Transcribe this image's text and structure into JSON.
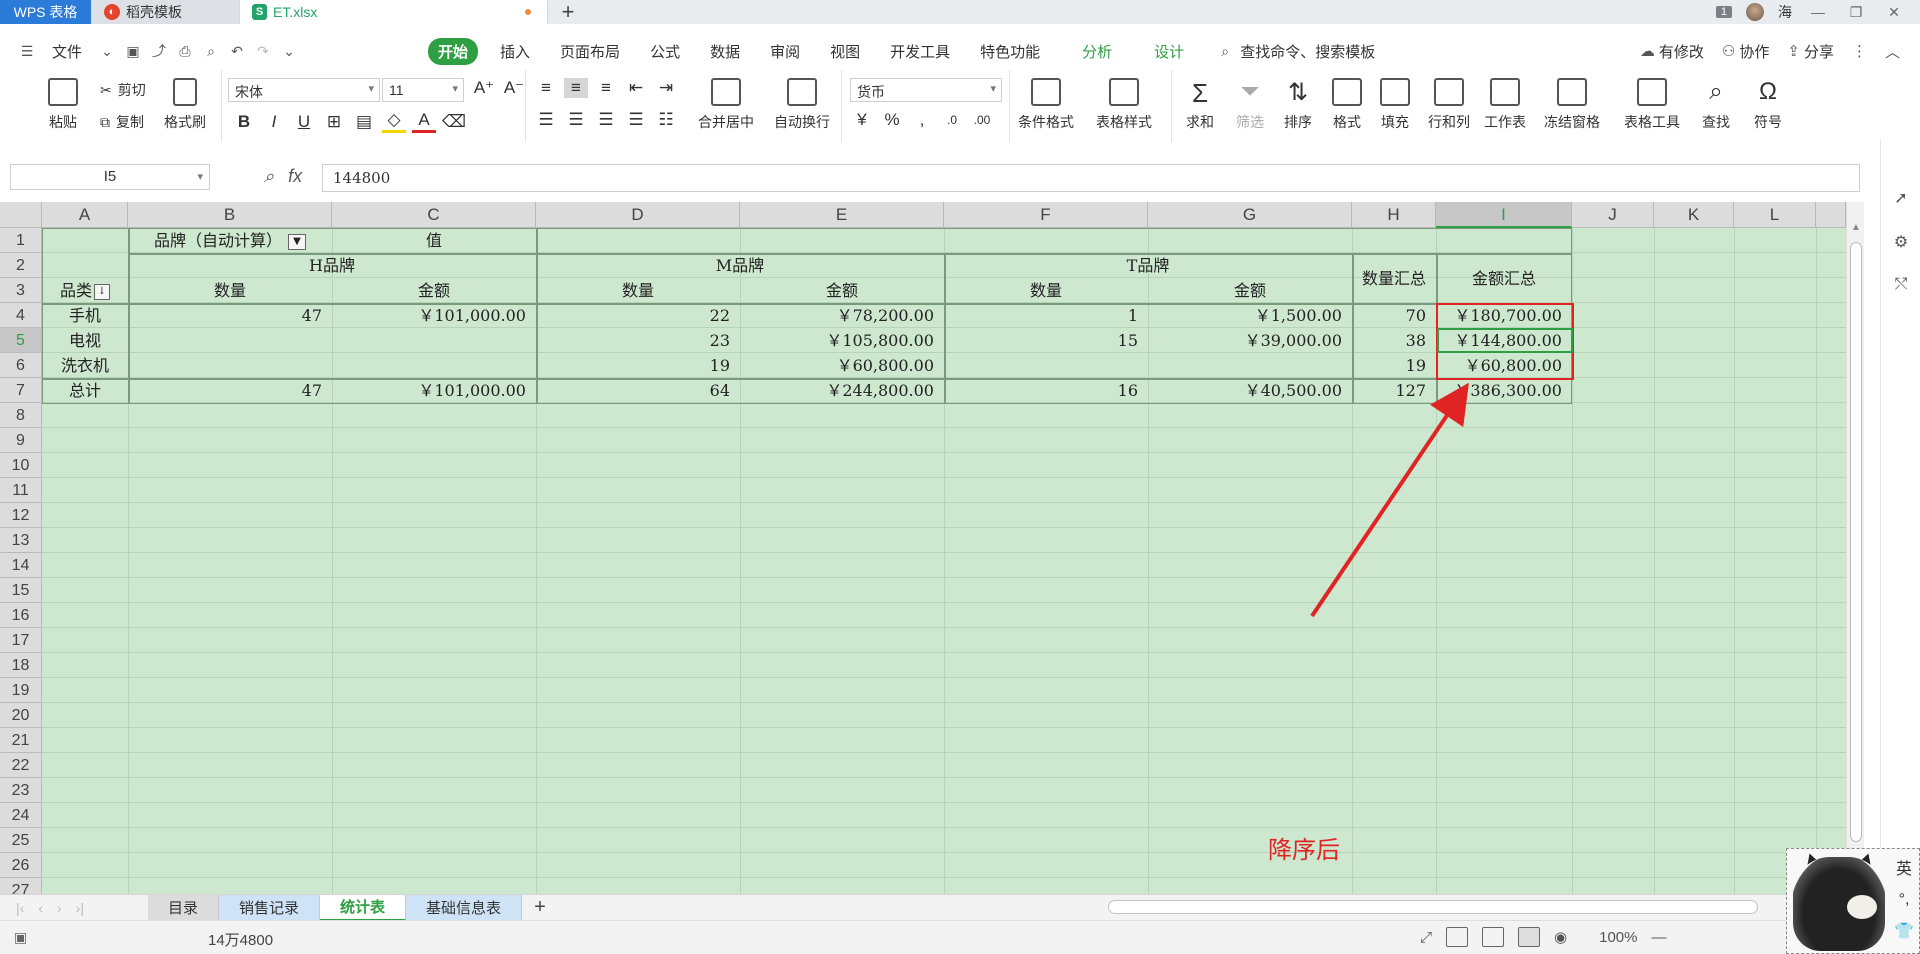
{
  "titlebar": {
    "tab_wps": "WPS 表格",
    "tab_template": "稻壳模板",
    "tab_file": "ET.xlsx",
    "template_icon": "daoke-logo-icon",
    "file_icon": "spreadsheet-icon",
    "count_badge": "1",
    "user_name": "海"
  },
  "menubar": {
    "file_label": "文件",
    "tabs": [
      "开始",
      "插入",
      "页面布局",
      "公式",
      "数据",
      "审阅",
      "视图",
      "开发工具",
      "特色功能",
      "分析",
      "设计"
    ],
    "search_placeholder": "查找命令、搜索模板",
    "has_changes": "有修改",
    "collab": "协作",
    "share": "分享"
  },
  "ribbon": {
    "paste": "粘贴",
    "cut": "剪切",
    "copy": "复制",
    "format_painter": "格式刷",
    "font_name": "宋体",
    "font_size": "11",
    "merge_center": "合并居中",
    "wrap_text": "自动换行",
    "number_format": "货币",
    "conditional_format": "条件格式",
    "table_style": "表格样式",
    "sum": "求和",
    "filter": "筛选",
    "sort": "排序",
    "format": "格式",
    "fill": "填充",
    "rows_cols": "行和列",
    "worksheet": "工作表",
    "freeze": "冻结窗格",
    "table_tools": "表格工具",
    "find": "查找",
    "symbol": "符号"
  },
  "formulabar": {
    "cell_ref": "I5",
    "fx": "fx",
    "formula": "144800"
  },
  "columns": [
    "A",
    "B",
    "C",
    "D",
    "E",
    "F",
    "G",
    "H",
    "I",
    "J",
    "K",
    "L"
  ],
  "rows": [
    "1",
    "2",
    "3",
    "4",
    "5",
    "6",
    "7",
    "8",
    "9",
    "10",
    "11",
    "12",
    "13",
    "14",
    "15",
    "16",
    "17",
    "18",
    "19",
    "20",
    "21",
    "22",
    "23",
    "24",
    "25",
    "26",
    "27"
  ],
  "pivot": {
    "r1": {
      "b": "品牌（自动计算）",
      "c": "值"
    },
    "r2": {
      "h_brand": "H品牌",
      "m_brand": "M品牌",
      "t_brand": "T品牌",
      "qty_total": "数量汇总",
      "amt_total": "金额汇总"
    },
    "r3": {
      "category": "品类",
      "h_qty": "数量",
      "h_amt": "金额",
      "m_qty": "数量",
      "m_amt": "金额",
      "t_qty": "数量",
      "t_amt": "金额"
    },
    "data_rows": [
      {
        "name": "手机",
        "h_qty": "47",
        "h_amt": "￥101,000.00",
        "m_qty": "22",
        "m_amt": "￥78,200.00",
        "t_qty": "1",
        "t_amt": "￥1,500.00",
        "qty_total": "70",
        "amt_total": "￥180,700.00"
      },
      {
        "name": "电视",
        "h_qty": "",
        "h_amt": "",
        "m_qty": "23",
        "m_amt": "￥105,800.00",
        "t_qty": "15",
        "t_amt": "￥39,000.00",
        "qty_total": "38",
        "amt_total": "￥144,800.00"
      },
      {
        "name": "洗衣机",
        "h_qty": "",
        "h_amt": "",
        "m_qty": "19",
        "m_amt": "￥60,800.00",
        "t_qty": "",
        "t_amt": "",
        "qty_total": "19",
        "amt_total": "￥60,800.00"
      },
      {
        "name": "总计",
        "h_qty": "47",
        "h_amt": "￥101,000.00",
        "m_qty": "64",
        "m_amt": "￥244,800.00",
        "t_qty": "16",
        "t_amt": "￥40,500.00",
        "qty_total": "127",
        "amt_total": "￥386,300.00"
      }
    ]
  },
  "annotation": "降序后",
  "sheets": [
    "目录",
    "销售记录",
    "统计表",
    "基础信息表"
  ],
  "active_sheet": "统计表",
  "status": {
    "sum_text": "14万4800",
    "zoom": "100%"
  },
  "ime": {
    "mode": "英"
  },
  "colors": {
    "accent": "#2ea043",
    "highlight": "#e02424",
    "grid_bg": "#cde8cf"
  }
}
